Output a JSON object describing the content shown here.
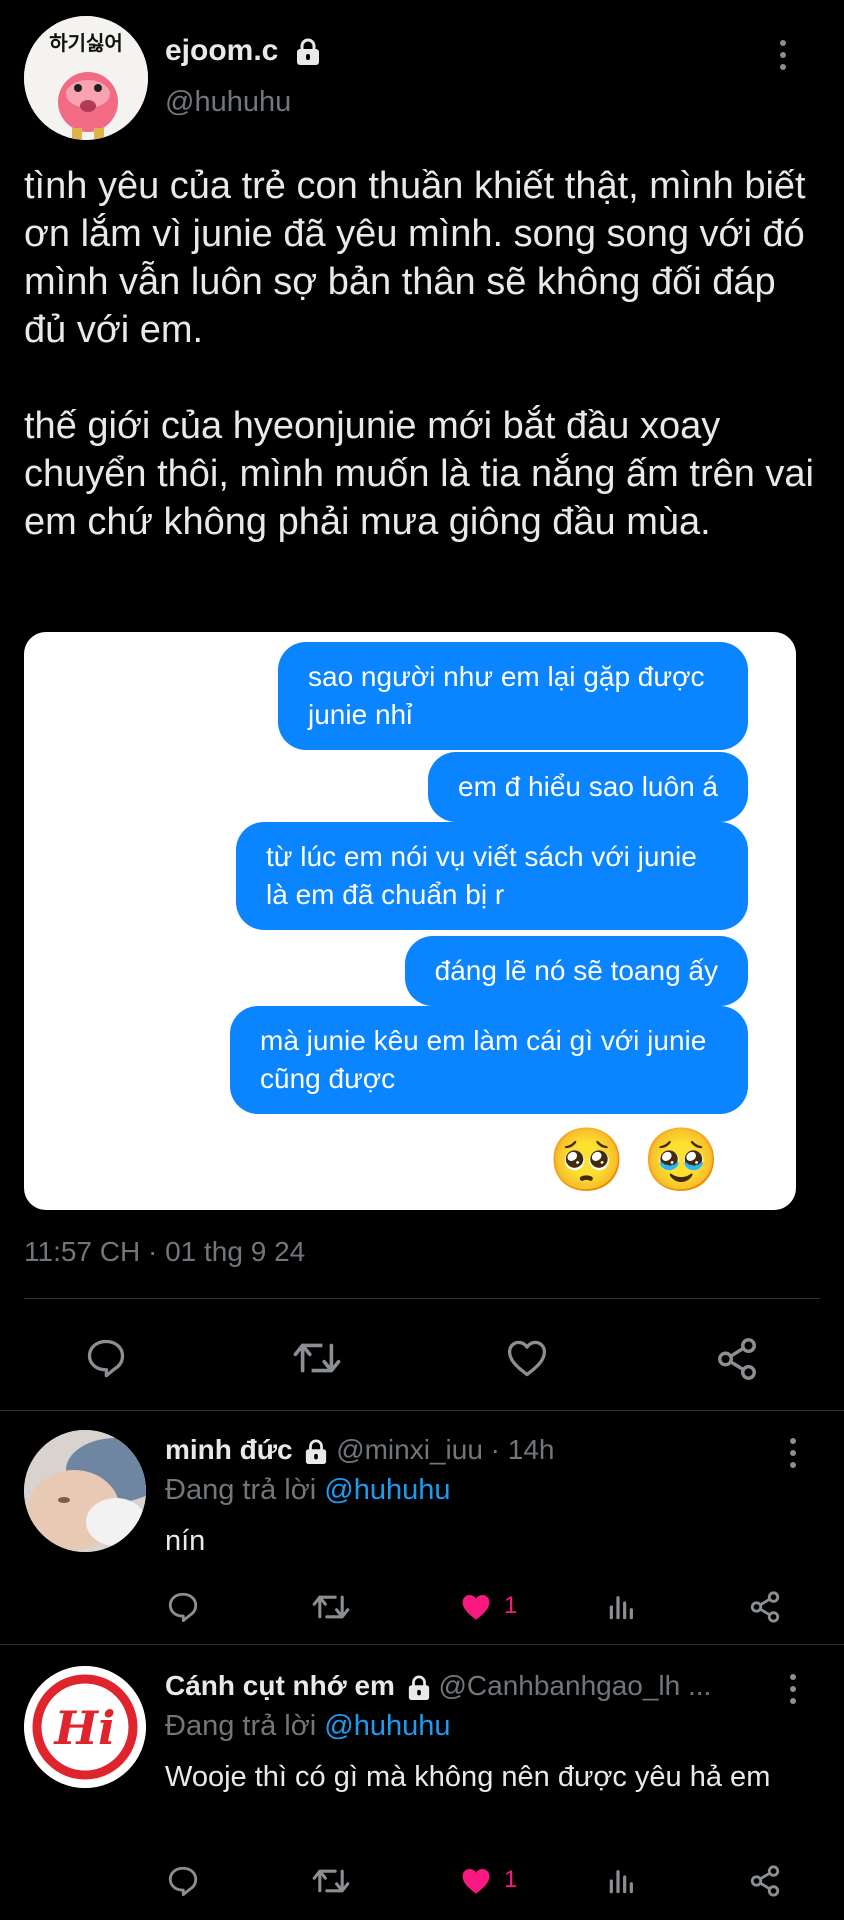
{
  "tweet": {
    "display_name": "ejoom.c",
    "handle": "@huhuhu",
    "avatar_caption": "하기싫어",
    "text": "tình yêu của trẻ con thuần khiết thật, mình biết ơn lắm vì junie đã yêu mình. song song với đó mình vẫn luôn sợ bản thân sẽ không đối đáp đủ với em.\n\nthế giới của hyeonjunie mới bắt đầu xoay chuyển thôi, mình muốn là tia nắng ấm trên vai em chứ không phải mưa giông đầu mùa.",
    "timestamp": "11:57 CH · 01 thg 9 24",
    "image": {
      "messages": [
        "sao người như em lại gặp được junie nhỉ",
        "em đ hiểu sao luôn á",
        "từ lúc em nói vụ viết sách với junie là em đã chuẩn bị r",
        "đáng lẽ nó sẽ toang ấy",
        "mà junie kêu em làm cái gì với junie cũng được"
      ],
      "emojis": [
        "🥺",
        "🥹"
      ]
    },
    "actions": [
      "reply-icon",
      "retweet-icon",
      "like-icon",
      "share-icon"
    ]
  },
  "replies": [
    {
      "name": "minh đức",
      "handle": "@minxi_iuu",
      "time": "14h",
      "replying_label": "Đang trả lời",
      "replying_to": "@huhuhu",
      "text": "nín",
      "likes": "1"
    },
    {
      "name": "Cánh cụt nhớ em",
      "handle": "@Canhbanhgao_lh ...",
      "time": "",
      "replying_label": "Đang trả lời",
      "replying_to": "@huhuhu",
      "text": "Wooje thì có gì mà không nên được yêu hả em",
      "likes": "1",
      "avatar_logo_text": "Hi"
    }
  ],
  "colors": {
    "background": "#000000",
    "bubble": "#0a84ff",
    "link": "#1d9bf0",
    "like": "#f91880",
    "muted": "#71767b"
  }
}
